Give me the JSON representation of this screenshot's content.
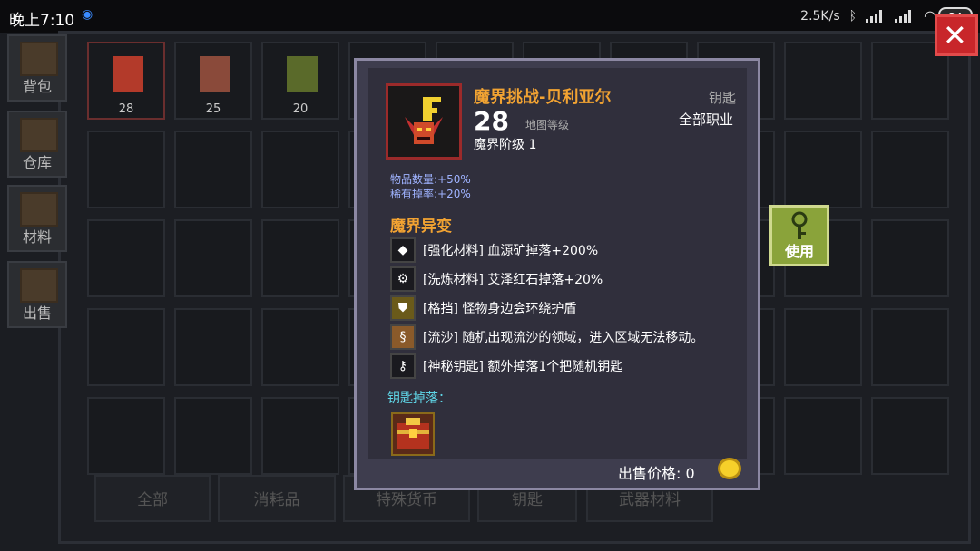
{
  "statusbar": {
    "time": "晚上7:10",
    "network_speed": "2.5K/s",
    "battery": "34"
  },
  "sidebar": {
    "tabs": [
      {
        "label": "背包"
      },
      {
        "label": "仓库"
      },
      {
        "label": "材料"
      },
      {
        "label": "出售"
      }
    ]
  },
  "inventory": {
    "items": [
      {
        "count": "28"
      },
      {
        "count": "25"
      },
      {
        "count": "20"
      }
    ],
    "bottom_tabs": [
      "全部",
      "消耗品",
      "特殊货币",
      "钥匙",
      "武器材料"
    ]
  },
  "tooltip": {
    "title": "魔界挑战-贝利亚尔",
    "level": "28",
    "level_label": "地图等级",
    "tier": "魔界阶级 1",
    "type": "钥匙",
    "class": "全部职业",
    "stats": [
      "物品数量:+50%",
      "稀有掉率:+20%"
    ],
    "mutation_title": "魔界异变",
    "mutations": [
      {
        "icon": "diamond-icon",
        "text": "[强化材料] 血源矿掉落+200%"
      },
      {
        "icon": "gear-icon",
        "text": "[洗炼材料] 艾泽红石掉落+20%"
      },
      {
        "icon": "shield-icon",
        "text": "[格挡] 怪物身边会环绕护盾"
      },
      {
        "icon": "quicksand-icon",
        "text": "[流沙] 随机出现流沙的领域，进入区域无法移动。"
      },
      {
        "icon": "key-icon",
        "text": "[神秘钥匙] 额外掉落1个把随机钥匙"
      }
    ],
    "drop_label": "钥匙掉落：",
    "sell_price_label": "出售价格: 0"
  },
  "use_button": {
    "label": "使用"
  },
  "colors": {
    "title_orange": "#f2a332",
    "stat_blue": "#9fb3ff",
    "drop_cyan": "#5fd5e6",
    "close_red": "#c8262a",
    "use_green": "#8aa33a"
  }
}
